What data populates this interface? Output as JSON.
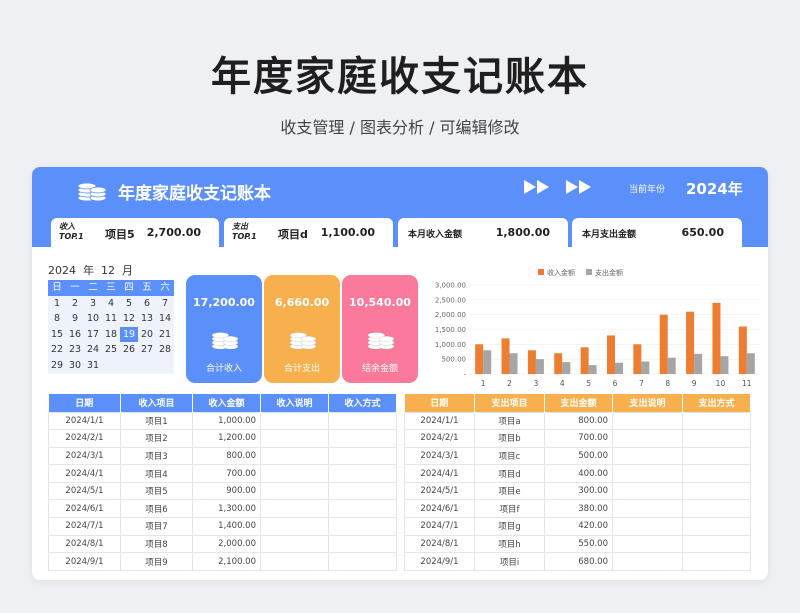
{
  "page": {
    "title": "年度家庭收支记账本",
    "subtitle": "收支管理 / 图表分析 / 可编辑修改"
  },
  "header": {
    "title": "年度家庭收支记账本",
    "year_label": "当前年份",
    "year": "2024年"
  },
  "kpis": {
    "income_top": {
      "tag1": "收入",
      "tag2": "TOP.1",
      "item": "项目5",
      "value": "2,700.00"
    },
    "expense_top": {
      "tag1": "支出",
      "tag2": "TOP.1",
      "item": "项目d",
      "value": "1,100.00"
    },
    "month_income": {
      "label": "本月收入金额",
      "value": "1,800.00"
    },
    "month_expense": {
      "label": "本月支出金额",
      "value": "650.00"
    }
  },
  "calendar": {
    "year": "2024",
    "year_unit": "年",
    "month": "12",
    "month_unit": "月",
    "weekdays": [
      "日",
      "一",
      "二",
      "三",
      "四",
      "五",
      "六"
    ],
    "days": [
      "1",
      "2",
      "3",
      "4",
      "5",
      "6",
      "7",
      "8",
      "9",
      "10",
      "11",
      "12",
      "13",
      "14",
      "15",
      "16",
      "17",
      "18",
      "19",
      "20",
      "21",
      "22",
      "23",
      "24",
      "25",
      "26",
      "27",
      "28",
      "29",
      "30",
      "31"
    ],
    "selected": "19"
  },
  "summary": [
    {
      "amount": "17,200.00",
      "label": "合计收入",
      "color": "#5b8ff9"
    },
    {
      "amount": "6,660.00",
      "label": "合计支出",
      "color": "#f8b04e"
    },
    {
      "amount": "10,540.00",
      "label": "结余金额",
      "color": "#fb7a9b"
    }
  ],
  "chart_data": {
    "type": "bar",
    "categories": [
      "1",
      "2",
      "3",
      "4",
      "5",
      "6",
      "7",
      "8",
      "9",
      "10",
      "11"
    ],
    "series": [
      {
        "name": "收入金额",
        "color": "#ed7d31",
        "values": [
          1000,
          1200,
          800,
          700,
          900,
          1300,
          1000,
          2000,
          2100,
          2400,
          1600
        ]
      },
      {
        "name": "支出金额",
        "color": "#a5a5a5",
        "values": [
          800,
          700,
          500,
          400,
          300,
          380,
          420,
          550,
          680,
          600,
          700
        ]
      }
    ],
    "yticks": [
      "-",
      "500.00",
      "1,000.00",
      "1,500.00",
      "2,000.00",
      "2,500.00",
      "3,000.00"
    ],
    "ylim": [
      0,
      3000
    ],
    "legend": "top"
  },
  "income_table": {
    "headers": [
      "日期",
      "收入项目",
      "收入金额",
      "收入说明",
      "收入方式"
    ],
    "rows": [
      [
        "2024/1/1",
        "项目1",
        "1,000.00",
        "",
        ""
      ],
      [
        "2024/2/1",
        "项目2",
        "1,200.00",
        "",
        ""
      ],
      [
        "2024/3/1",
        "项目3",
        "800.00",
        "",
        ""
      ],
      [
        "2024/4/1",
        "项目4",
        "700.00",
        "",
        ""
      ],
      [
        "2024/5/1",
        "项目5",
        "900.00",
        "",
        ""
      ],
      [
        "2024/6/1",
        "项目6",
        "1,300.00",
        "",
        ""
      ],
      [
        "2024/7/1",
        "项目7",
        "1,400.00",
        "",
        ""
      ],
      [
        "2024/8/1",
        "项目8",
        "2,000.00",
        "",
        ""
      ],
      [
        "2024/9/1",
        "项目9",
        "2,100.00",
        "",
        ""
      ]
    ]
  },
  "expense_table": {
    "headers": [
      "日期",
      "支出项目",
      "支出金额",
      "支出说明",
      "支出方式"
    ],
    "rows": [
      [
        "2024/1/1",
        "项目a",
        "800.00",
        "",
        ""
      ],
      [
        "2024/2/1",
        "项目b",
        "700.00",
        "",
        ""
      ],
      [
        "2024/3/1",
        "项目c",
        "500.00",
        "",
        ""
      ],
      [
        "2024/4/1",
        "项目d",
        "400.00",
        "",
        ""
      ],
      [
        "2024/5/1",
        "项目e",
        "300.00",
        "",
        ""
      ],
      [
        "2024/6/1",
        "项目f",
        "380.00",
        "",
        ""
      ],
      [
        "2024/7/1",
        "项目g",
        "420.00",
        "",
        ""
      ],
      [
        "2024/8/1",
        "项目h",
        "550.00",
        "",
        ""
      ],
      [
        "2024/9/1",
        "项目i",
        "680.00",
        "",
        ""
      ]
    ]
  }
}
